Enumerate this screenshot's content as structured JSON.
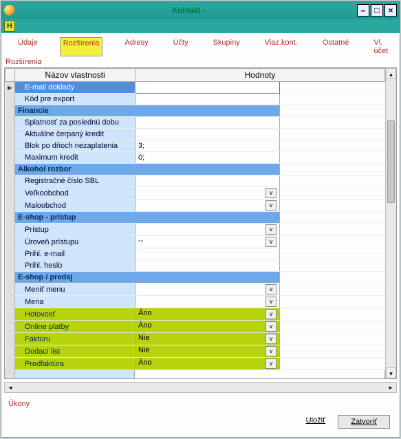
{
  "window": {
    "title": "Kontakt -"
  },
  "toolbar": {
    "h_button": "H"
  },
  "tabs": {
    "items": [
      {
        "label": "Údaje"
      },
      {
        "label": "Rozšírenia"
      },
      {
        "label": "Adresy"
      },
      {
        "label": "Účty"
      },
      {
        "label": "Skupiny"
      },
      {
        "label": "Viaz.kont."
      },
      {
        "label": "Ostatné"
      },
      {
        "label": "Vl. účet"
      }
    ],
    "section_label": "Rozšírenia"
  },
  "grid": {
    "header_name": "Názov vlastnosti",
    "header_value": "Hodnoty",
    "rows": [
      {
        "type": "item",
        "name": "E-mail doklady",
        "value": "",
        "selected": true,
        "editing": true
      },
      {
        "type": "item",
        "name": "Kód pre export",
        "value": ""
      },
      {
        "type": "group",
        "name": "Financie"
      },
      {
        "type": "item",
        "name": "Splatnosť za poslednú dobu",
        "value": ""
      },
      {
        "type": "item",
        "name": "Aktuálne čerpaný kredit",
        "value": ""
      },
      {
        "type": "item",
        "name": "Blok po dňoch nezaplatenia",
        "value": "3;"
      },
      {
        "type": "item",
        "name": "Maximum kredit",
        "value": "0;"
      },
      {
        "type": "group",
        "name": "Alkohol rozbor"
      },
      {
        "type": "item",
        "name": "Registračné číslo SBL",
        "value": ""
      },
      {
        "type": "item",
        "name": "Veľkoobchod",
        "value": "",
        "dropdown": true
      },
      {
        "type": "item",
        "name": "Maloobchod",
        "value": "",
        "dropdown": true
      },
      {
        "type": "group",
        "name": "E-shop - prístup"
      },
      {
        "type": "item",
        "name": "Prístup",
        "value": "",
        "dropdown": true
      },
      {
        "type": "item",
        "name": "Úroveň prístupu",
        "value": "--",
        "dropdown": true
      },
      {
        "type": "item",
        "name": "Prihl. e-mail",
        "value": ""
      },
      {
        "type": "item",
        "name": "Prihl. heslo",
        "value": ""
      },
      {
        "type": "group",
        "name": "E-shop / predaj"
      },
      {
        "type": "item",
        "name": "Meniť menu",
        "value": "",
        "dropdown": true
      },
      {
        "type": "item",
        "name": "Mena",
        "value": "",
        "dropdown": true,
        "highlight_start": true
      },
      {
        "type": "item",
        "name": "Hotovosť",
        "value": "Áno",
        "dropdown": true,
        "highlight": true
      },
      {
        "type": "item",
        "name": "Online platby",
        "value": "Áno",
        "dropdown": true,
        "highlight": true
      },
      {
        "type": "item",
        "name": "Faktúru",
        "value": "Nie",
        "dropdown": true,
        "highlight": true
      },
      {
        "type": "item",
        "name": "Dodací list",
        "value": "Nie",
        "dropdown": true,
        "highlight": true
      },
      {
        "type": "item",
        "name": "Predfaktúra",
        "value": "Áno",
        "dropdown": true,
        "highlight": true
      }
    ]
  },
  "footer": {
    "ukony": "Úkony",
    "save": "Uložiť",
    "close": "Zatvoriť"
  }
}
